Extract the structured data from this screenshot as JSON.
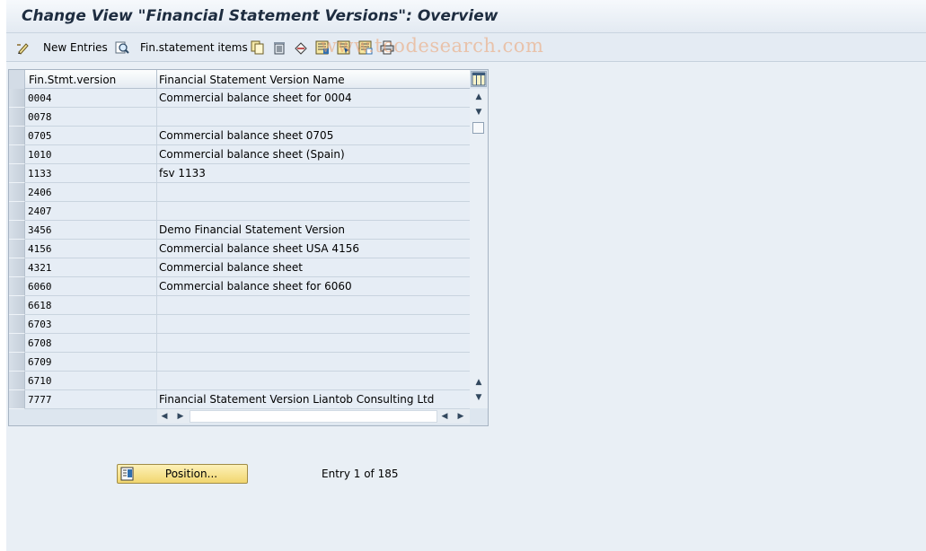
{
  "window": {
    "title": "Change View \"Financial Statement Versions\": Overview"
  },
  "toolbar": {
    "new_entries_label": "New Entries",
    "fin_statement_items_label": "Fin.statement items",
    "icons": [
      "change-icon",
      "details-icon",
      "copy-icon",
      "delete-icon",
      "undo-icon",
      "select-all-icon",
      "select-block-icon",
      "deselect-all-icon",
      "print-icon"
    ]
  },
  "watermark": "www.tcodesearch.com",
  "table": {
    "columns": [
      "Fin.Stmt.version",
      "Financial Statement Version Name"
    ],
    "rows": [
      {
        "version": "0004",
        "name": "Commercial balance sheet for 0004"
      },
      {
        "version": "0078",
        "name": ""
      },
      {
        "version": "0705",
        "name": "Commercial balance sheet 0705"
      },
      {
        "version": "1010",
        "name": "Commercial balance sheet (Spain)"
      },
      {
        "version": "1133",
        "name": "fsv 1133"
      },
      {
        "version": "2406",
        "name": ""
      },
      {
        "version": "2407",
        "name": ""
      },
      {
        "version": "3456",
        "name": "Demo Financial Statement Version"
      },
      {
        "version": "4156",
        "name": "Commercial balance sheet USA 4156"
      },
      {
        "version": "4321",
        "name": "Commercial balance sheet"
      },
      {
        "version": "6060",
        "name": "Commercial balance sheet for 6060"
      },
      {
        "version": "6618",
        "name": ""
      },
      {
        "version": "6703",
        "name": ""
      },
      {
        "version": "6708",
        "name": ""
      },
      {
        "version": "6709",
        "name": ""
      },
      {
        "version": "6710",
        "name": ""
      },
      {
        "version": "7777",
        "name": "Financial Statement Version Liantob Consulting Ltd"
      }
    ]
  },
  "footer": {
    "position_button_label": "Position...",
    "entry_info": "Entry 1 of 185"
  },
  "colors": {
    "background": "#eaf0f6",
    "title_text": "#1e2d40",
    "position_button": "#f1d66f"
  }
}
